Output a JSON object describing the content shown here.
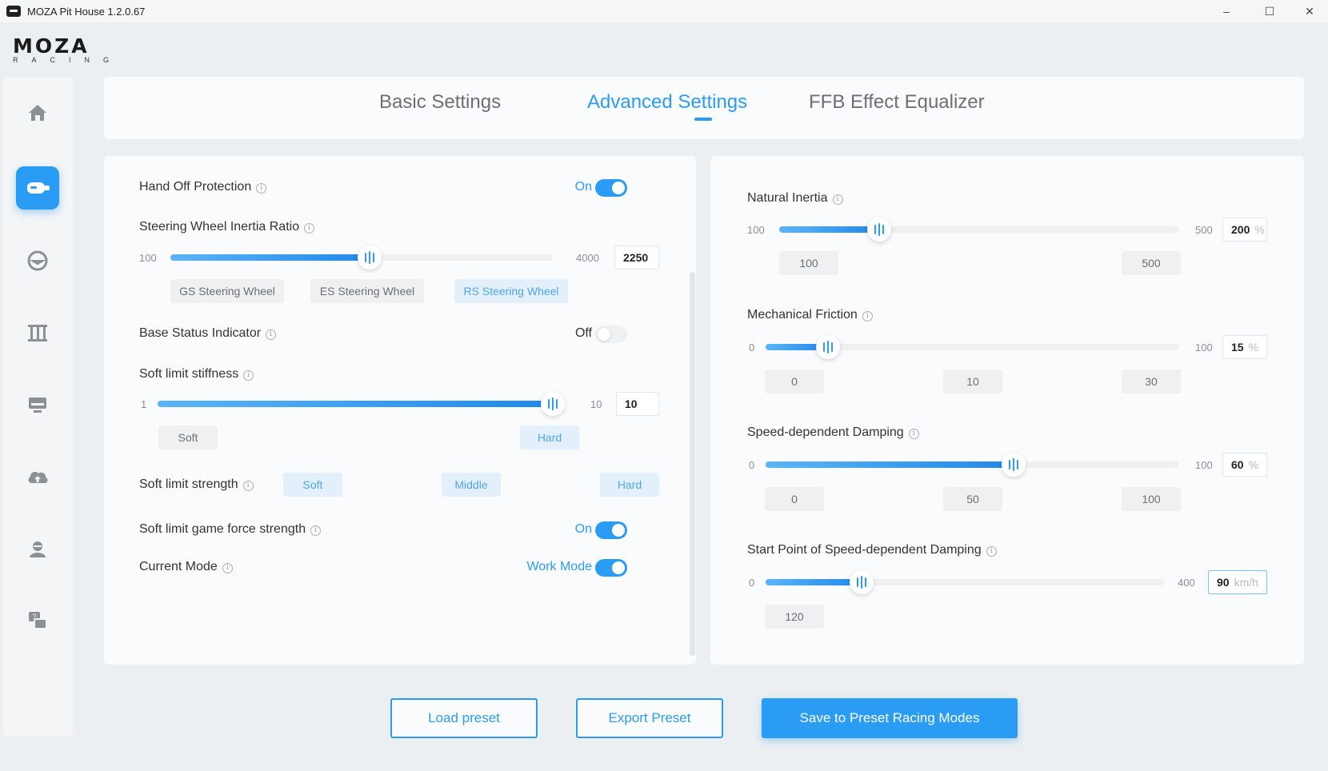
{
  "window": {
    "title": "MOZA Pit House 1.2.0.67",
    "minimize": "–",
    "maximize": "☐",
    "close": "✕"
  },
  "logo": {
    "main": "MOZA",
    "sub": "RACING"
  },
  "sidebar": {
    "items": [
      {
        "icon": "home-icon"
      },
      {
        "icon": "wheelbase-icon",
        "active": true
      },
      {
        "icon": "steering-wheel-icon"
      },
      {
        "icon": "pedals-icon"
      },
      {
        "icon": "dashboard-icon"
      },
      {
        "icon": "cloud-upload-icon"
      },
      {
        "icon": "user-icon"
      },
      {
        "icon": "support-icon"
      }
    ]
  },
  "tabs": [
    {
      "label": "Basic Settings",
      "active": false
    },
    {
      "label": "Advanced Settings",
      "active": true
    },
    {
      "label": "FFB Effect Equalizer",
      "active": false
    }
  ],
  "info_glyph": "i",
  "left": {
    "hand_off": {
      "label": "Hand Off Protection",
      "state": "On",
      "on": true
    },
    "inertia_ratio": {
      "label": "Steering Wheel Inertia Ratio",
      "min": "100",
      "max": "4000",
      "value": "2250",
      "level": 0.52,
      "presets": [
        "GS Steering Wheel",
        "ES Steering Wheel",
        "RS Steering Wheel"
      ],
      "selected": 2
    },
    "base_status": {
      "label": "Base Status Indicator",
      "state": "Off",
      "on": false
    },
    "soft_stiffness": {
      "label": "Soft limit stiffness",
      "min": "1",
      "max": "10",
      "value": "10",
      "level": 1.0,
      "presets": [
        "Soft",
        "Hard"
      ],
      "selected": 1
    },
    "soft_strength": {
      "label": "Soft limit strength",
      "options": [
        "Soft",
        "Middle",
        "Hard"
      ]
    },
    "soft_game_force": {
      "label": "Soft limit game force strength",
      "state": "On",
      "on": true
    },
    "current_mode": {
      "label": "Current Mode",
      "state": "Work Mode",
      "on": true
    }
  },
  "right": {
    "natural_inertia": {
      "label": "Natural Inertia",
      "min": "100",
      "max": "500",
      "value": "200",
      "unit": "%",
      "level": 0.25,
      "presets": [
        "100",
        "500"
      ]
    },
    "mech_friction": {
      "label": "Mechanical Friction",
      "min": "0",
      "max": "100",
      "value": "15",
      "unit": "%",
      "level": 0.15,
      "presets": [
        "0",
        "10",
        "30"
      ]
    },
    "speed_damping": {
      "label": "Speed-dependent Damping",
      "min": "0",
      "max": "100",
      "value": "60",
      "unit": "%",
      "level": 0.6,
      "presets": [
        "0",
        "50",
        "100"
      ]
    },
    "start_point": {
      "label": "Start Point of Speed-dependent Damping",
      "min": "0",
      "max": "400",
      "value": "90",
      "unit": "km/h",
      "level": 0.24,
      "presets": [
        "120"
      ]
    }
  },
  "buttons": {
    "load": "Load preset",
    "export": "Export Preset",
    "save": "Save to Preset Racing Modes"
  },
  "colors": {
    "accent": "#2b9cf4",
    "chip_bg": "#eef0f2",
    "chip_sel_bg": "#e3f0fc"
  }
}
